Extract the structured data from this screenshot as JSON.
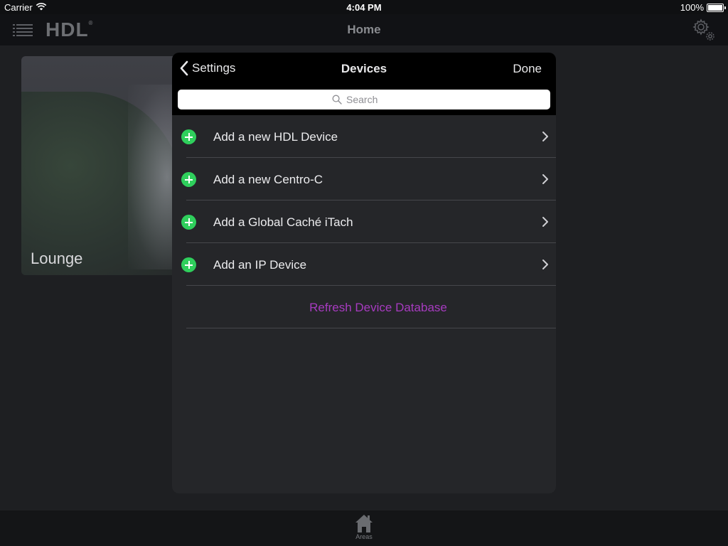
{
  "status_bar": {
    "carrier": "Carrier",
    "time": "4:04 PM",
    "battery_percent": "100%",
    "icons": [
      "wifi-icon",
      "battery-icon"
    ]
  },
  "nav_bar": {
    "logo_text": "HDL",
    "logo_mark": "®",
    "title": "Home",
    "icons": [
      "menu-list-icon",
      "settings-gear-icon"
    ]
  },
  "background": {
    "area_card_label": "Lounge"
  },
  "modal": {
    "back_label": "Settings",
    "title": "Devices",
    "done_label": "Done",
    "search_placeholder": "Search",
    "items": [
      {
        "label": "Add a new HDL Device"
      },
      {
        "label": "Add a new Centro-C"
      },
      {
        "label": "Add a Global Caché iTach"
      },
      {
        "label": "Add an IP Device"
      }
    ],
    "refresh_label": "Refresh Device Database"
  },
  "tab_bar": {
    "tabs": [
      {
        "label": "Areas",
        "icon": "house-icon"
      }
    ]
  },
  "colors": {
    "accent_green": "#2fcf5c",
    "refresh_purple": "#a73bc0",
    "modal_bg": "#252629",
    "header_bg": "#000000"
  }
}
